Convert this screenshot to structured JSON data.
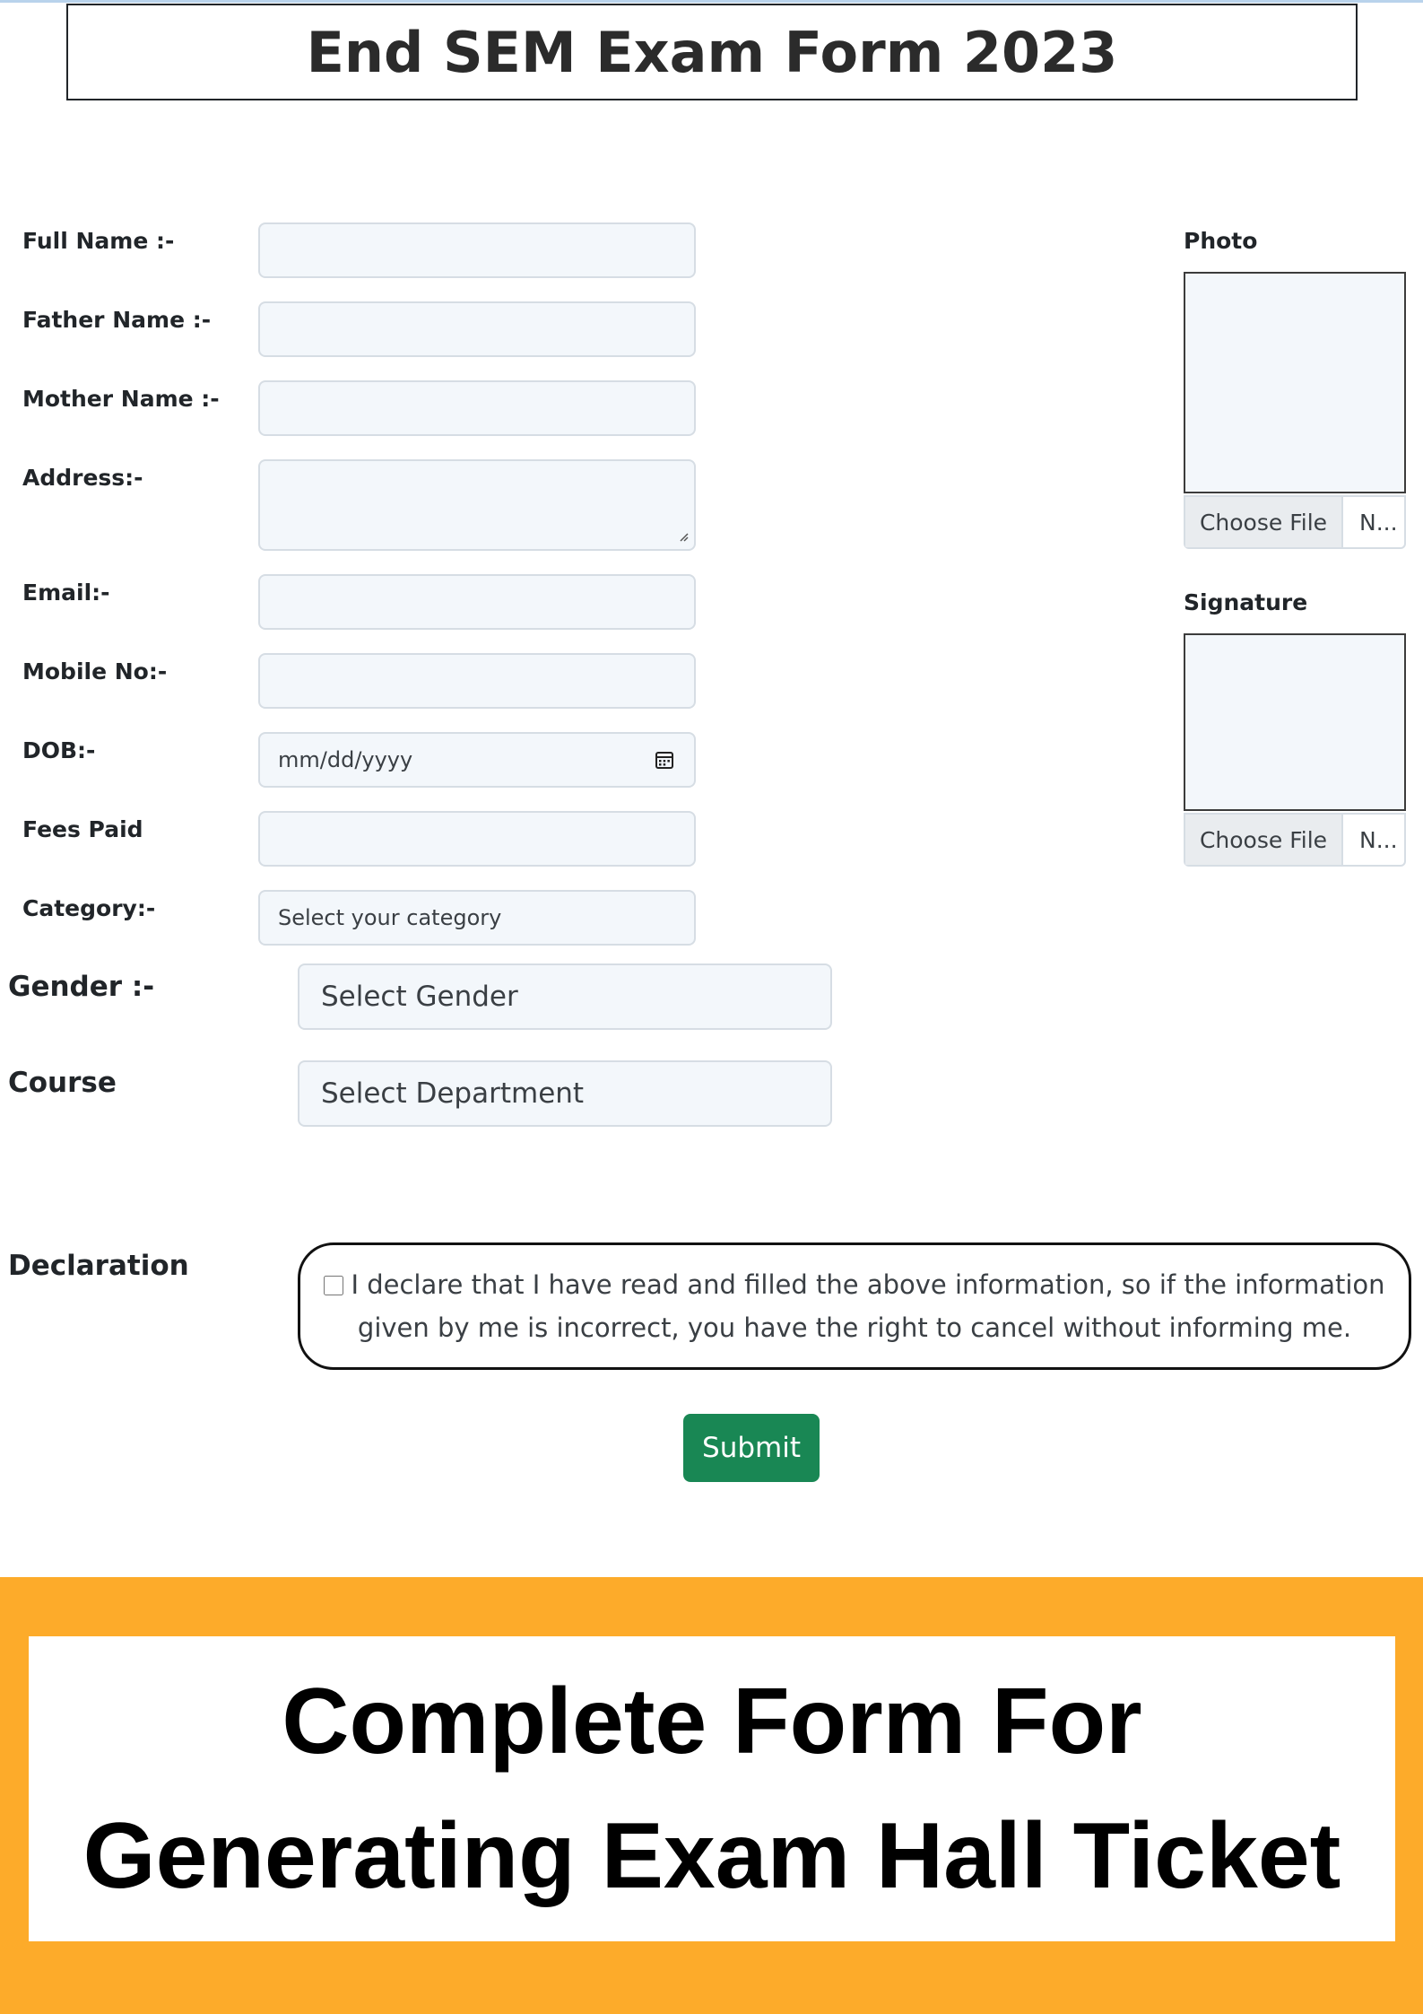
{
  "header": {
    "title": "End SEM Exam Form 2023"
  },
  "form": {
    "full_name_label": "Full Name :-",
    "father_name_label": "Father Name :-",
    "mother_name_label": "Mother Name :-",
    "address_label": "Address:-",
    "email_label": "Email:-",
    "mobile_label": "Mobile No:-",
    "dob_label": "DOB:-",
    "dob_placeholder": "mm/dd/yyyy",
    "fees_label": "Fees Paid",
    "category_label": "Category:-",
    "category_selected": "Select your category",
    "gender_label": "Gender :-",
    "gender_selected": "Select Gender",
    "course_label": "Course",
    "course_selected": "Select Department",
    "declaration_label": "Declaration",
    "declaration_text": "I declare that I have read and filled the above information, so if the information given by me is incorrect, you have the right to cancel without informing me.",
    "submit_label": "Submit"
  },
  "uploads": {
    "photo_label": "Photo",
    "signature_label": "Signature",
    "choose_file_label": "Choose File",
    "file_name_truncated": "N..."
  },
  "icons": {
    "calendar": "calendar-icon",
    "resize_handle": "resize-handle-icon"
  },
  "banner": {
    "line1": "Complete Form For",
    "line2": "Generating Exam Hall Ticket",
    "background_color": "#fdab2a"
  },
  "colors": {
    "submit": "#198754",
    "field_bg": "#f3f7fb"
  }
}
